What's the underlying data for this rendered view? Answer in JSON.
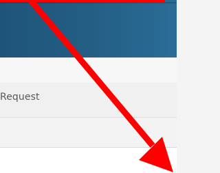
{
  "header": {
    "background_color": "#245f86"
  },
  "menu": {
    "items": [
      {
        "label": "Request"
      }
    ]
  },
  "annotation": {
    "color": "#ff0000",
    "icon": "red-arrow-annotation"
  }
}
